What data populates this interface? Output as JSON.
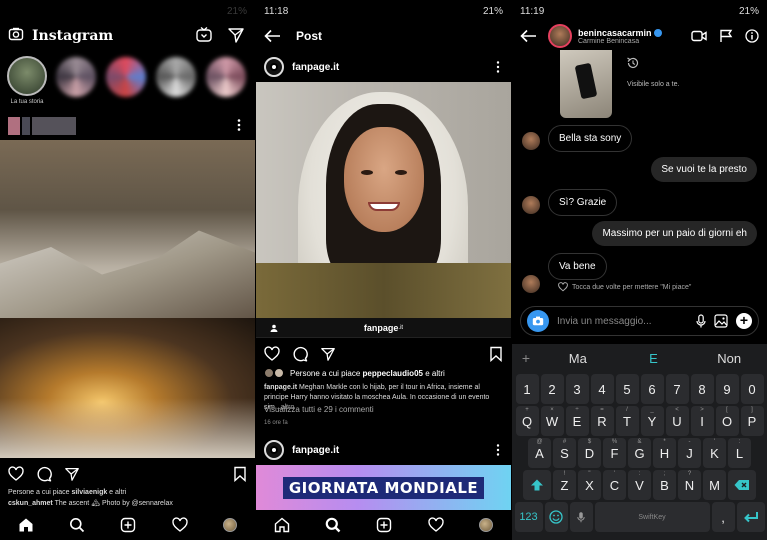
{
  "panel1": {
    "status": {
      "time": "",
      "battery": "21%"
    },
    "app_title": "Instagram",
    "own_story_label": "La tua storia",
    "likes_line": {
      "prefix": "Persone a cui piace ",
      "user": "silviaenigk",
      "suffix": " e altri"
    },
    "caption": {
      "user": "cskun_ahmet",
      "text": " The ascent 🏔 Photo by @sennarelax"
    }
  },
  "panel2": {
    "status": {
      "time": "11:18",
      "battery": "21%"
    },
    "title": "Post",
    "account": "fanpage.it",
    "credit_label": "fanpage",
    "credit_suffix": ".it",
    "likes": {
      "prefix": "Persone a cui piace ",
      "user": "peppeclaudio05",
      "suffix": " e altri"
    },
    "caption": {
      "user": "fanpage.it",
      "text": " Meghan Markle con lo hijab, per il tour in Africa, insieme al principe Harry hanno visitato la moschea Aula. In occasione di un evento sim",
      "more": "...altro"
    },
    "comments": "Visualizza tutti e 29 i commenti",
    "time_ago": "16 ore fa",
    "next_account": "fanpage.it",
    "banner": "GIORNATA MONDIALE"
  },
  "panel3": {
    "status": {
      "time": "11:19",
      "battery": "21%"
    },
    "contact_username": "benincasacarmin",
    "contact_name": "Carmine Benincasa",
    "visible_note": "Visibile solo a te.",
    "messages": [
      {
        "dir": "in",
        "text": "Bella sta sony"
      },
      {
        "dir": "out",
        "text": "Se vuoi te la presto"
      },
      {
        "dir": "in",
        "text": "Sì? Grazie"
      },
      {
        "dir": "out",
        "text": "Massimo per un paio di giorni eh"
      },
      {
        "dir": "in",
        "text": "Va bene"
      }
    ],
    "like_hint": "Tocca due volte per mettere \"Mi piace\"",
    "input_placeholder": "Invia un messaggio...",
    "keyboard": {
      "suggestions": [
        "Ma",
        "E",
        "Non"
      ],
      "row_numbers": [
        "1",
        "2",
        "3",
        "4",
        "5",
        "6",
        "7",
        "8",
        "9",
        "0"
      ],
      "row1": [
        "Q",
        "W",
        "E",
        "R",
        "T",
        "Y",
        "U",
        "I",
        "O",
        "P"
      ],
      "row1_alt": [
        "+",
        "×",
        "÷",
        "=",
        "/",
        "_",
        "<",
        ">",
        "[",
        "]"
      ],
      "row2": [
        "A",
        "S",
        "D",
        "F",
        "G",
        "H",
        "J",
        "K",
        "L"
      ],
      "row2_alt": [
        "@",
        "#",
        "$",
        "%",
        "&",
        "*",
        "-",
        "'",
        ":"
      ],
      "row3": [
        "Z",
        "X",
        "C",
        "V",
        "B",
        "N",
        "M"
      ],
      "row3_alt": [
        "!",
        "\"",
        "'",
        ":",
        ";",
        "?",
        ""
      ],
      "symbols_key": "123",
      "space_label": "SwiftKey",
      "comma": ","
    }
  }
}
